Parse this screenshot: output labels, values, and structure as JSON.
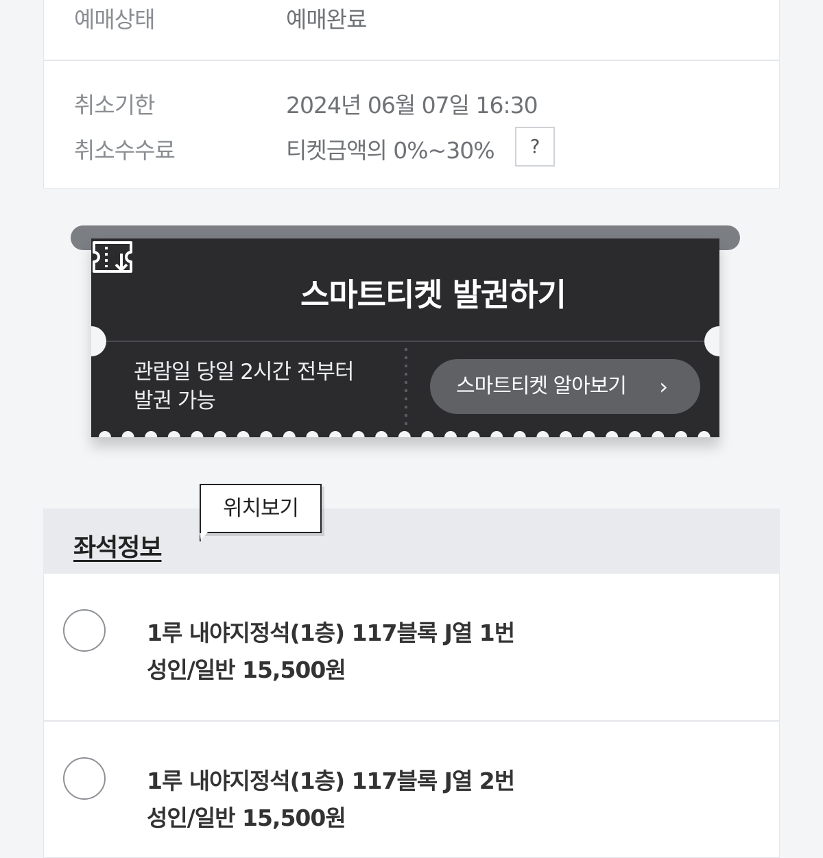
{
  "booking": {
    "status_label": "예매상태",
    "status_value": "예매완료",
    "cancel_deadline_label": "취소기한",
    "cancel_deadline_value": "2024년 06월 07일 16:30",
    "cancel_fee_label": "취소수수료",
    "cancel_fee_value": "티켓금액의 0%~30%",
    "help_label": "?"
  },
  "smart_ticket": {
    "title": "스마트티켓 발권하기",
    "note_line1": "관람일 당일 2시간 전부터",
    "note_line2": "발권 가능",
    "learn_more_label": "스마트티켓 알아보기",
    "chevron": "›",
    "icon": "ticket-download-icon"
  },
  "seats": {
    "section_title": "좌석정보",
    "tooltip_label": "위치보기",
    "items": [
      {
        "name": "1루 내야지정석(1층) 117블록 J열 1번",
        "price": "성인/일반 15,500원"
      },
      {
        "name": "1루 내야지정석(1층) 117블록 J열 2번",
        "price": "성인/일반 15,500원"
      }
    ]
  }
}
